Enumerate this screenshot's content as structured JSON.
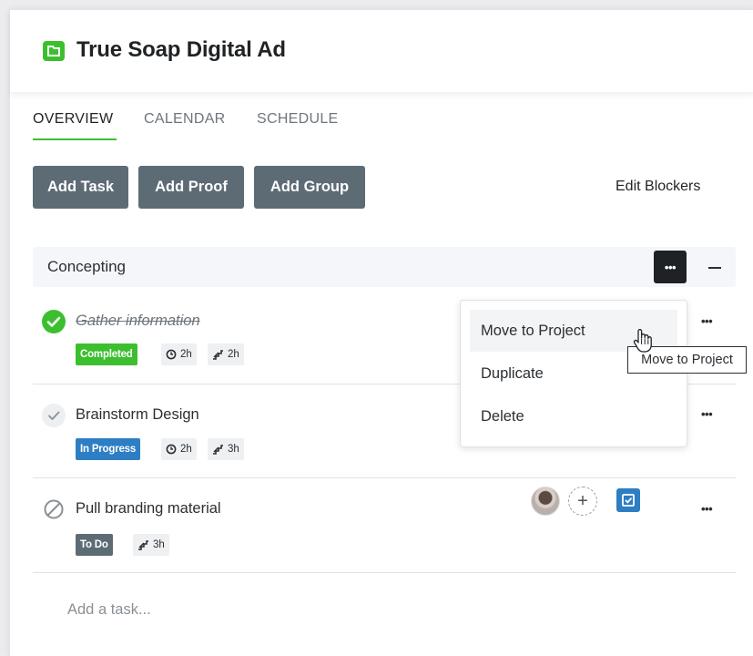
{
  "project": {
    "title": "True Soap Digital Ad",
    "icon": "folder-icon",
    "icon_color": "#3cbf2f"
  },
  "tabs": [
    {
      "label": "OVERVIEW",
      "active": true
    },
    {
      "label": "CALENDAR",
      "active": false
    },
    {
      "label": "SCHEDULE",
      "active": false
    }
  ],
  "actions": {
    "add_task": "Add Task",
    "add_proof": "Add Proof",
    "add_group": "Add Group",
    "edit_blockers": "Edit Blockers"
  },
  "group": {
    "title": "Concepting"
  },
  "tasks": [
    {
      "name": "Gather information",
      "status": "Completed",
      "status_color": "#3cbf2f",
      "time": "2h",
      "effort": "2h"
    },
    {
      "name": "Brainstorm Design",
      "status": "In Progress",
      "status_color": "#2e7ec4",
      "time": "2h",
      "effort": "3h"
    },
    {
      "name": "Pull branding material",
      "status": "To Do",
      "status_color": "#5d6b75",
      "effort": "3h"
    }
  ],
  "context_menu": {
    "items": [
      "Move to Project",
      "Duplicate",
      "Delete"
    ],
    "hovered": "Move to Project"
  },
  "tooltip": "Move to Project",
  "add_task_placeholder": "Add a task..."
}
